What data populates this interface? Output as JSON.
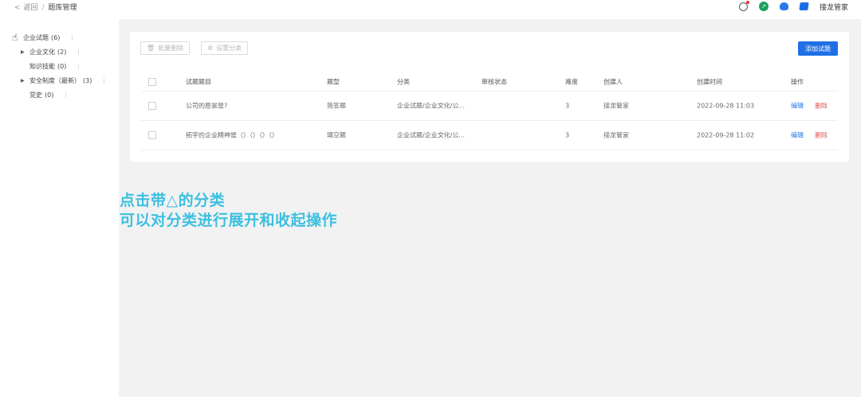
{
  "header": {
    "back_label": "返回",
    "separator": "/",
    "page_title": "题库管理",
    "user_name": "接龙管家"
  },
  "sidebar": {
    "items": [
      {
        "label": "企业试题",
        "count": "(6)",
        "expandable": false
      },
      {
        "label": "企业文化",
        "count": "(2)",
        "expandable": true
      },
      {
        "label": "知识技能",
        "count": "(0)",
        "expandable": false
      },
      {
        "label": "安全制度（最新）",
        "count": "(3)",
        "expandable": true
      },
      {
        "label": "党史",
        "count": "(0)",
        "expandable": false
      }
    ],
    "more_glyph": "⋮"
  },
  "toolbar": {
    "batch_delete_label": "批量删除",
    "set_category_label": "设置分类",
    "add_question_label": "添加试题"
  },
  "table": {
    "headers": [
      "试题题目",
      "题型",
      "分类",
      "审核状态",
      "难度",
      "创建人",
      "创建时间",
      "操作"
    ],
    "rows": [
      {
        "title": "公司的愿景是?",
        "type": "简答题",
        "category": "企业试题/企业文化/公...",
        "review_status": "",
        "difficulty": "3",
        "creator": "接龙管家",
        "created_at": "2022-09-28 11:03",
        "edit": "编辑",
        "delete": "删除"
      },
      {
        "title": "拓宇的企业精神是（）（）（）（）",
        "type": "填空题",
        "category": "企业试题/企业文化/公...",
        "review_status": "",
        "difficulty": "3",
        "creator": "接龙管家",
        "created_at": "2022-09-28 11:02",
        "edit": "编辑",
        "delete": "删除"
      }
    ]
  },
  "overlay": {
    "line1": "点击带△的分类",
    "line2": "可以对分类进行展开和收起操作"
  },
  "colors": {
    "primary": "#1f6fe6",
    "overlay_text": "#3cc0e0",
    "delete": "#e05050"
  }
}
